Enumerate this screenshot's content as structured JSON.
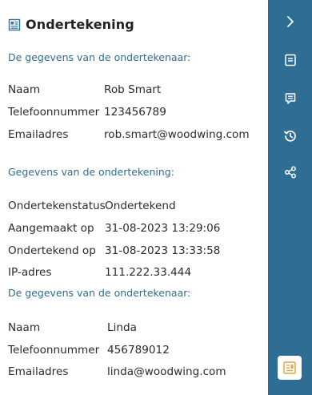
{
  "panel": {
    "title": "Ondertekening",
    "signer_section_1": {
      "heading": "De gegevens van de ondertekenaar:",
      "fields": [
        {
          "label": "Naam",
          "value": "Rob Smart"
        },
        {
          "label": "Telefoonnummer",
          "value": "123456789"
        },
        {
          "label": "Emailadres",
          "value": "rob.smart@woodwing.com"
        }
      ]
    },
    "signature_section": {
      "heading": "Gegevens van de ondertekening:",
      "fields": [
        {
          "label": "Ondertekenstatus",
          "value": "Ondertekend"
        },
        {
          "label": "Aangemaakt op",
          "value": "31-08-2023 13:29:06"
        },
        {
          "label": "Ondertekend op",
          "value": "31-08-2023 13:33:58"
        },
        {
          "label": "IP-adres",
          "value": "111.222.33.444"
        }
      ]
    },
    "signer_section_2": {
      "heading": "De gegevens van de ondertekenaar:",
      "fields": [
        {
          "label": "Naam",
          "value": "Linda"
        },
        {
          "label": "Telefoonnummer",
          "value": "456789012"
        },
        {
          "label": "Emailadres",
          "value": "linda@woodwing.com"
        }
      ]
    }
  },
  "sidebar": {
    "icons": [
      "chevron-right-icon",
      "document-icon",
      "comment-icon",
      "history-icon",
      "share-icon",
      "signature-panel-icon"
    ],
    "colors": {
      "background": "#2e6e95",
      "accent_bottom": "#e8a33d"
    }
  }
}
